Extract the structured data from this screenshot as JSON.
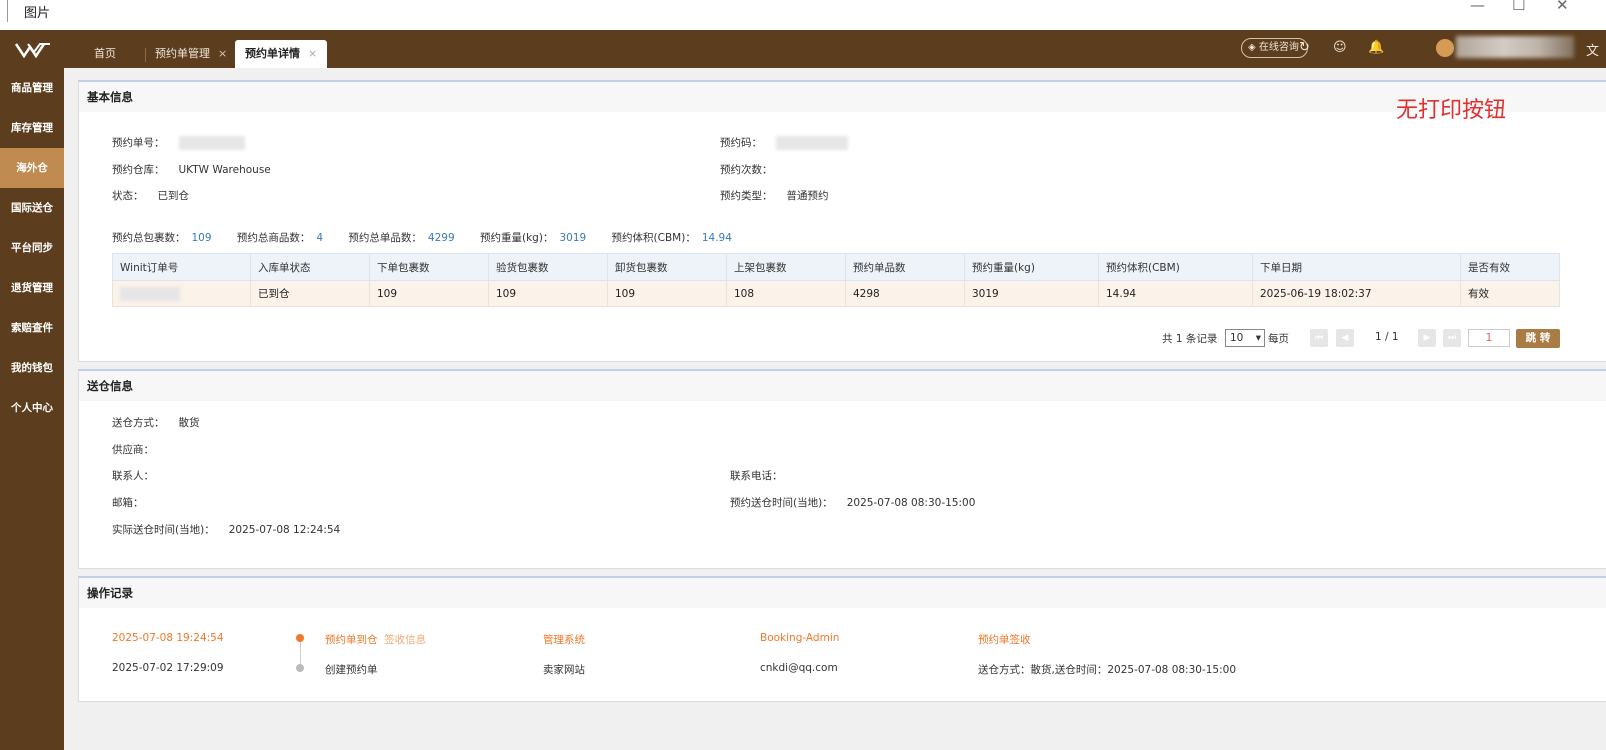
{
  "window": {
    "title": "图片",
    "minimize": "—",
    "maximize": "☐",
    "close": "✕"
  },
  "tabs": [
    {
      "label": "首页"
    },
    {
      "label": "预约单管理",
      "close": "×"
    },
    {
      "label": "预约单详情",
      "close": "×"
    }
  ],
  "header": {
    "consult_label": "在线咨询"
  },
  "sidebar": {
    "items": [
      {
        "label": "商品管理"
      },
      {
        "label": "库存管理"
      },
      {
        "label": "海外仓"
      },
      {
        "label": "国际送仓"
      },
      {
        "label": "平台同步"
      },
      {
        "label": "退货管理"
      },
      {
        "label": "索赔查件"
      },
      {
        "label": "我的钱包"
      },
      {
        "label": "个人中心"
      }
    ],
    "active_index": 2
  },
  "basic": {
    "title": "基本信息",
    "booking_no_label": "预约单号：",
    "booking_code_label": "预约码：",
    "warehouse_label": "预约仓库：",
    "warehouse_value": "UKTW Warehouse",
    "times_label": "预约次数：",
    "status_label": "状态：",
    "status_value": "已到仓",
    "type_label": "预约类型：",
    "type_value": "普通预约",
    "stats": [
      {
        "label": "预约总包裹数：",
        "value": "109"
      },
      {
        "label": "预约总商品数：",
        "value": "4"
      },
      {
        "label": "预约总单品数：",
        "value": "4299"
      },
      {
        "label": "预约重量(kg)：",
        "value": "3019"
      },
      {
        "label": "预约体积(CBM)：",
        "value": "14.94"
      }
    ],
    "table": {
      "headers": [
        "Winit订单号",
        "入库单状态",
        "下单包裹数",
        "验货包裹数",
        "卸货包裹数",
        "上架包裹数",
        "预约单品数",
        "预约重量(kg)",
        "预约体积(CBM)",
        "下单日期",
        "是否有效"
      ],
      "row": [
        "",
        "已到仓",
        "109",
        "109",
        "109",
        "108",
        "4298",
        "3019",
        "14.94",
        "2025-06-19 18:02:37",
        "有效"
      ]
    },
    "pager": {
      "total": "共 1 条记录",
      "page_size": "10",
      "per_page": "每页",
      "page_info": "1 / 1",
      "page_input": "1",
      "jump": "跳 转"
    }
  },
  "annotation": "无打印按钮",
  "delivery": {
    "title": "送仓信息",
    "method_label": "送仓方式：",
    "method_value": "散货",
    "supplier_label": "供应商：",
    "contact_label": "联系人：",
    "phone_label": "联系电话：",
    "email_label": "邮箱：",
    "booked_time_label": "预约送仓时间(当地)：",
    "booked_time_value": "2025-07-08 08:30-15:00",
    "actual_time_label": "实际送仓时间(当地)：",
    "actual_time_value": "2025-07-08 12:24:54"
  },
  "ops": {
    "title": "操作记录",
    "records": [
      {
        "time": "2025-07-08 19:24:54",
        "action": "预约单到仓",
        "extra": "签收信息",
        "system": "管理系统",
        "user": "Booking-Admin",
        "detail": "预约单签收"
      },
      {
        "time": "2025-07-02 17:29:09",
        "action": "创建预约单",
        "extra": "",
        "system": "卖家网站",
        "user": "cnkdi@qq.com",
        "detail": "送仓方式：散货,送仓时间：2025-07-08 08:30-15:00"
      }
    ]
  },
  "colors": {
    "brand": "#5c3d1e",
    "accent": "#c08b50",
    "link": "#3a7bb5",
    "highlight": "#f07828",
    "annotation": "#e03030"
  }
}
